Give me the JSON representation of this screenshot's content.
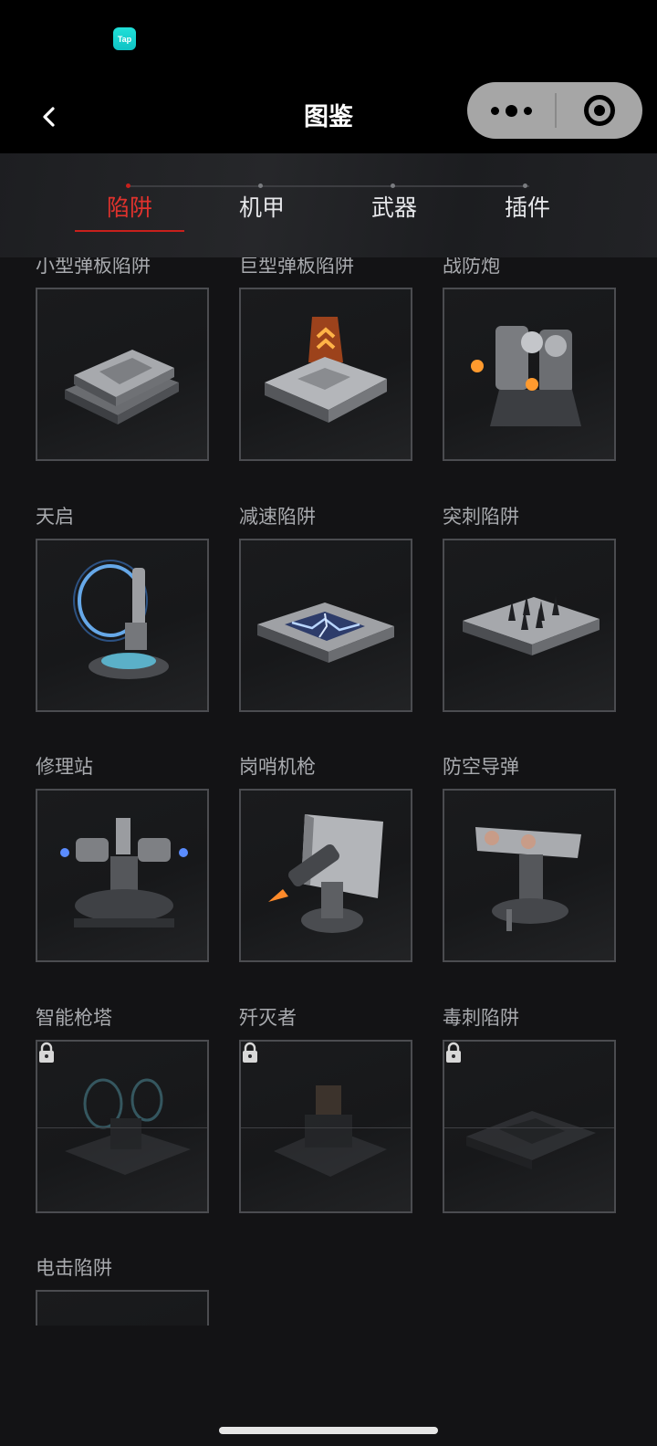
{
  "status_bar": {
    "app_badge": "Tap"
  },
  "nav": {
    "title": "图鉴"
  },
  "tabs": [
    {
      "label": "陷阱",
      "active": true
    },
    {
      "label": "机甲",
      "active": false
    },
    {
      "label": "武器",
      "active": false
    },
    {
      "label": "插件",
      "active": false
    }
  ],
  "items": [
    {
      "name": "小型弹板陷阱",
      "locked": false
    },
    {
      "name": "巨型弹板陷阱",
      "locked": false
    },
    {
      "name": "战防炮",
      "locked": false
    },
    {
      "name": "天启",
      "locked": false
    },
    {
      "name": "减速陷阱",
      "locked": false
    },
    {
      "name": "突刺陷阱",
      "locked": false
    },
    {
      "name": "修理站",
      "locked": false
    },
    {
      "name": "岗哨机枪",
      "locked": false
    },
    {
      "name": "防空导弹",
      "locked": false
    },
    {
      "name": "智能枪塔",
      "locked": true
    },
    {
      "name": "歼灭者",
      "locked": true
    },
    {
      "name": "毒刺陷阱",
      "locked": true
    },
    {
      "name": "电击陷阱",
      "locked": false
    }
  ],
  "colors": {
    "accent": "#e0322d",
    "background": "#131315"
  }
}
